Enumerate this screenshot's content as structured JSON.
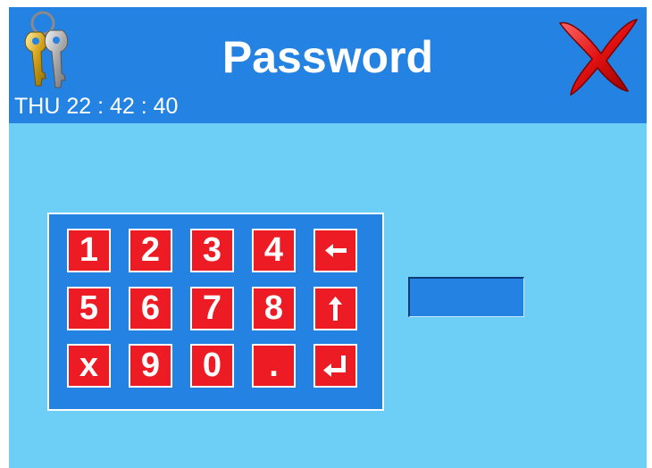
{
  "header": {
    "title": "Password",
    "clock": "THU 22 : 42 : 40"
  },
  "icons": {
    "keys": "keys-icon",
    "close": "close-icon",
    "backspace": "arrow-left-icon",
    "shift": "arrow-up-icon",
    "enter": "enter-icon"
  },
  "keypad": {
    "keys": [
      "1",
      "2",
      "3",
      "4",
      "←",
      "5",
      "6",
      "7",
      "8",
      "↑",
      "x",
      "9",
      "0",
      ".",
      "↵"
    ]
  },
  "password_field": {
    "value": ""
  },
  "colors": {
    "header": "#2483e2",
    "background": "#6dcff6",
    "key": "#ed1c24",
    "text": "#ffffff"
  }
}
